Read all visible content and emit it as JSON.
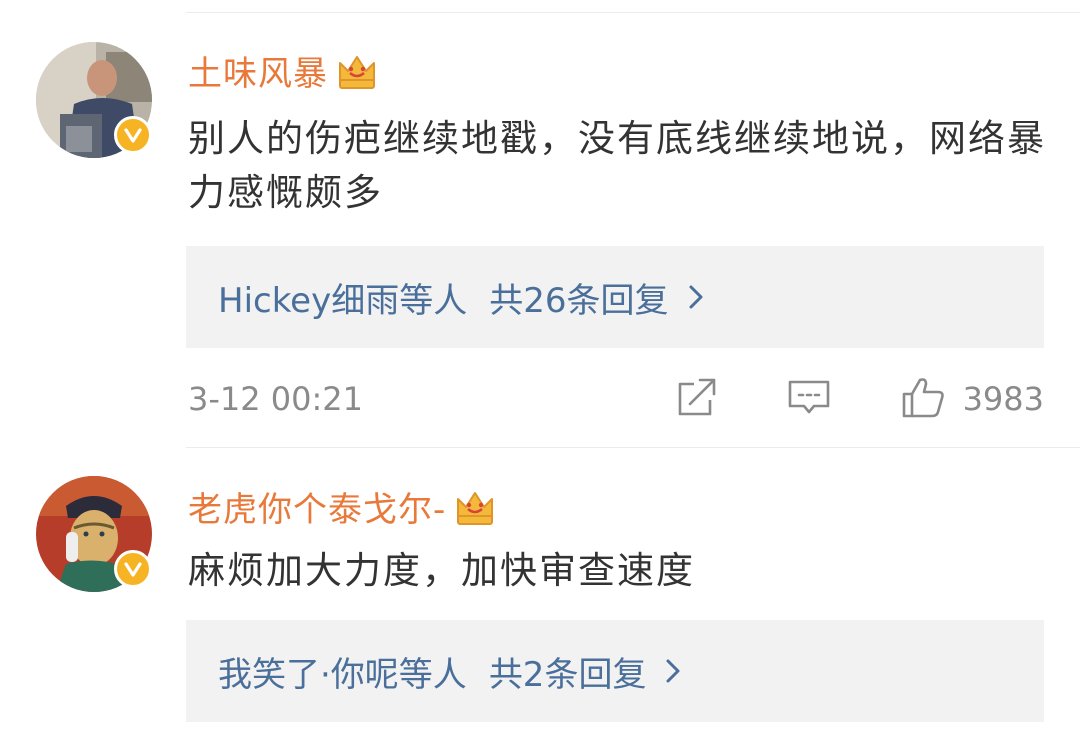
{
  "comments": [
    {
      "username": "土味风暴",
      "avatar": "photo-avatar",
      "badges": [
        "crown-icon",
        "verified-icon"
      ],
      "text": "别人的伤疤继续地戳，没有底线继续地说，网络暴力感慨颇多",
      "reply_summary": {
        "who": "Hickey细雨等人",
        "count_text": "共26条回复"
      },
      "timestamp": "3-12 00:21",
      "likes": "3983"
    },
    {
      "username": "老虎你个泰戈尔-",
      "avatar": "painting-avatar",
      "badges": [
        "crown-icon",
        "verified-icon"
      ],
      "text": "麻烦加大力度，加快审查速度",
      "reply_summary": {
        "who": "我笑了·你呢等人",
        "count_text": "共2条回复"
      }
    }
  ],
  "colors": {
    "username": "#e8793a",
    "link": "#4a6f9a",
    "body_text": "#333333",
    "meta_text": "#8a8a8a",
    "reply_bg": "#f2f2f2",
    "verified_badge": "#f6b425"
  }
}
